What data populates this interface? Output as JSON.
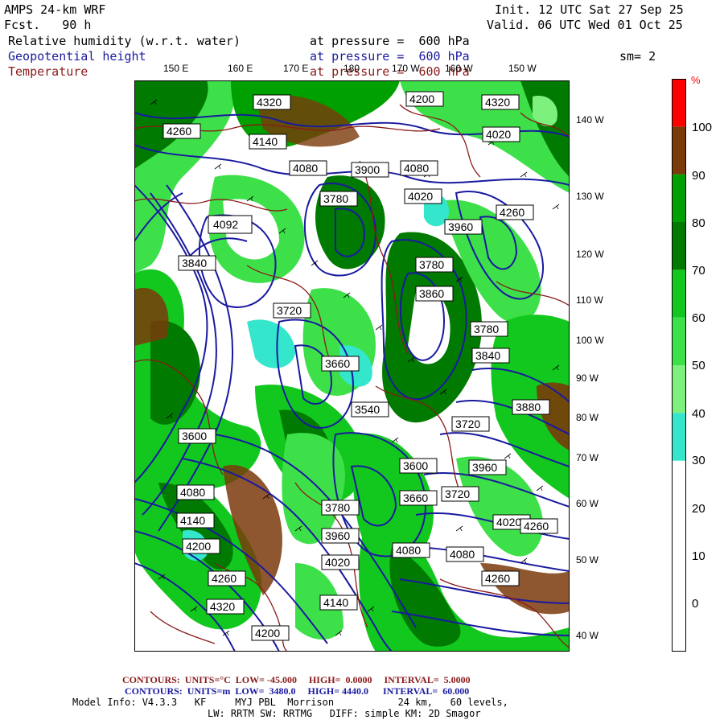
{
  "header": {
    "model": "AMPS 24-km WRF",
    "fcst": "Fcst.   90 h",
    "init": "Init. 12 UTC Sat 27 Sep 25",
    "valid": "Valid. 06 UTC Wed 01 Oct 25",
    "rows": [
      {
        "field": "Relative humidity (w.r.t. water)",
        "level": "at pressure =  600 hPa",
        "color": "#000000"
      },
      {
        "field": "Geopotential height",
        "level": "at pressure =  600 hPa",
        "color": "#1a1aa0"
      },
      {
        "field": "Temperature",
        "level": "at pressure =  600 hPa",
        "color": "#8b1a1a"
      }
    ],
    "smoothing": "sm= 2"
  },
  "longitude_labels": [
    "150 E",
    "160 E",
    "170 E",
    "180",
    "170 W",
    "160 W",
    "150 W"
  ],
  "latitude_labels": [
    "140 W",
    "130 W",
    "120 W",
    "110 W",
    "100 W",
    "90 W",
    "80 W",
    "70 W",
    "60 W",
    "50 W",
    "40 W"
  ],
  "height_labels": [
    "4320",
    "4200",
    "4260",
    "4140",
    "4080",
    "3900",
    "4080",
    "4020",
    "3780",
    "4020",
    "4092",
    "3960",
    "3840",
    "3780",
    "3720",
    "3660",
    "3600",
    "3540",
    "3720",
    "3780",
    "3960",
    "4020",
    "4080",
    "4140",
    "4200",
    "4260",
    "4320",
    "4260",
    "4200",
    "4080",
    "4140",
    "4080",
    "4020",
    "3960",
    "3840",
    "3780",
    "3720",
    "3660",
    "3600",
    "4260",
    "4320",
    "4260",
    "3900",
    "3860",
    "3880"
  ],
  "colorbar": {
    "unit": "%",
    "segments": [
      {
        "color": "#ffffff",
        "from": -10,
        "to": 30
      },
      {
        "color": "#33e6cc",
        "from": 30,
        "to": 40
      },
      {
        "color": "#7ef07e",
        "from": 40,
        "to": 50
      },
      {
        "color": "#3ee04a",
        "from": 50,
        "to": 60
      },
      {
        "color": "#12c81e",
        "from": 60,
        "to": 70
      },
      {
        "color": "#007a00",
        "from": 70,
        "to": 80
      },
      {
        "color": "#00a000",
        "from": 80,
        "to": 90
      },
      {
        "color": "#7a3a0a",
        "from": 90,
        "to": 100
      },
      {
        "color": "#ff0000",
        "from": 100,
        "to": 110
      }
    ],
    "labels": [
      "100",
      "90",
      "80",
      "70",
      "60",
      "50",
      "40",
      "30",
      "20",
      "10",
      "0"
    ]
  },
  "footer": {
    "temp_contours": {
      "label": "CONTOURS:",
      "units": "UNITS=°C",
      "low": "LOW= -45.000",
      "high": "HIGH=  0.0000",
      "interval": "INTERVAL=  5.0000",
      "color": "#8b1a1a"
    },
    "height_contours": {
      "label": "CONTOURS:",
      "units": "UNITS=m",
      "low": "LOW=  3480.0",
      "high": "HIGH= 4440.0",
      "interval": "INTERVAL=  60.000",
      "color": "#1a1aa0"
    },
    "model_info": "Model Info: V4.3.3   KF     MYJ PBL  Morrison           24 km,   60 levels,",
    "model_info2": "LW: RRTM SW: RRTMG   DIFF: simple KM: 2D Smagor"
  }
}
